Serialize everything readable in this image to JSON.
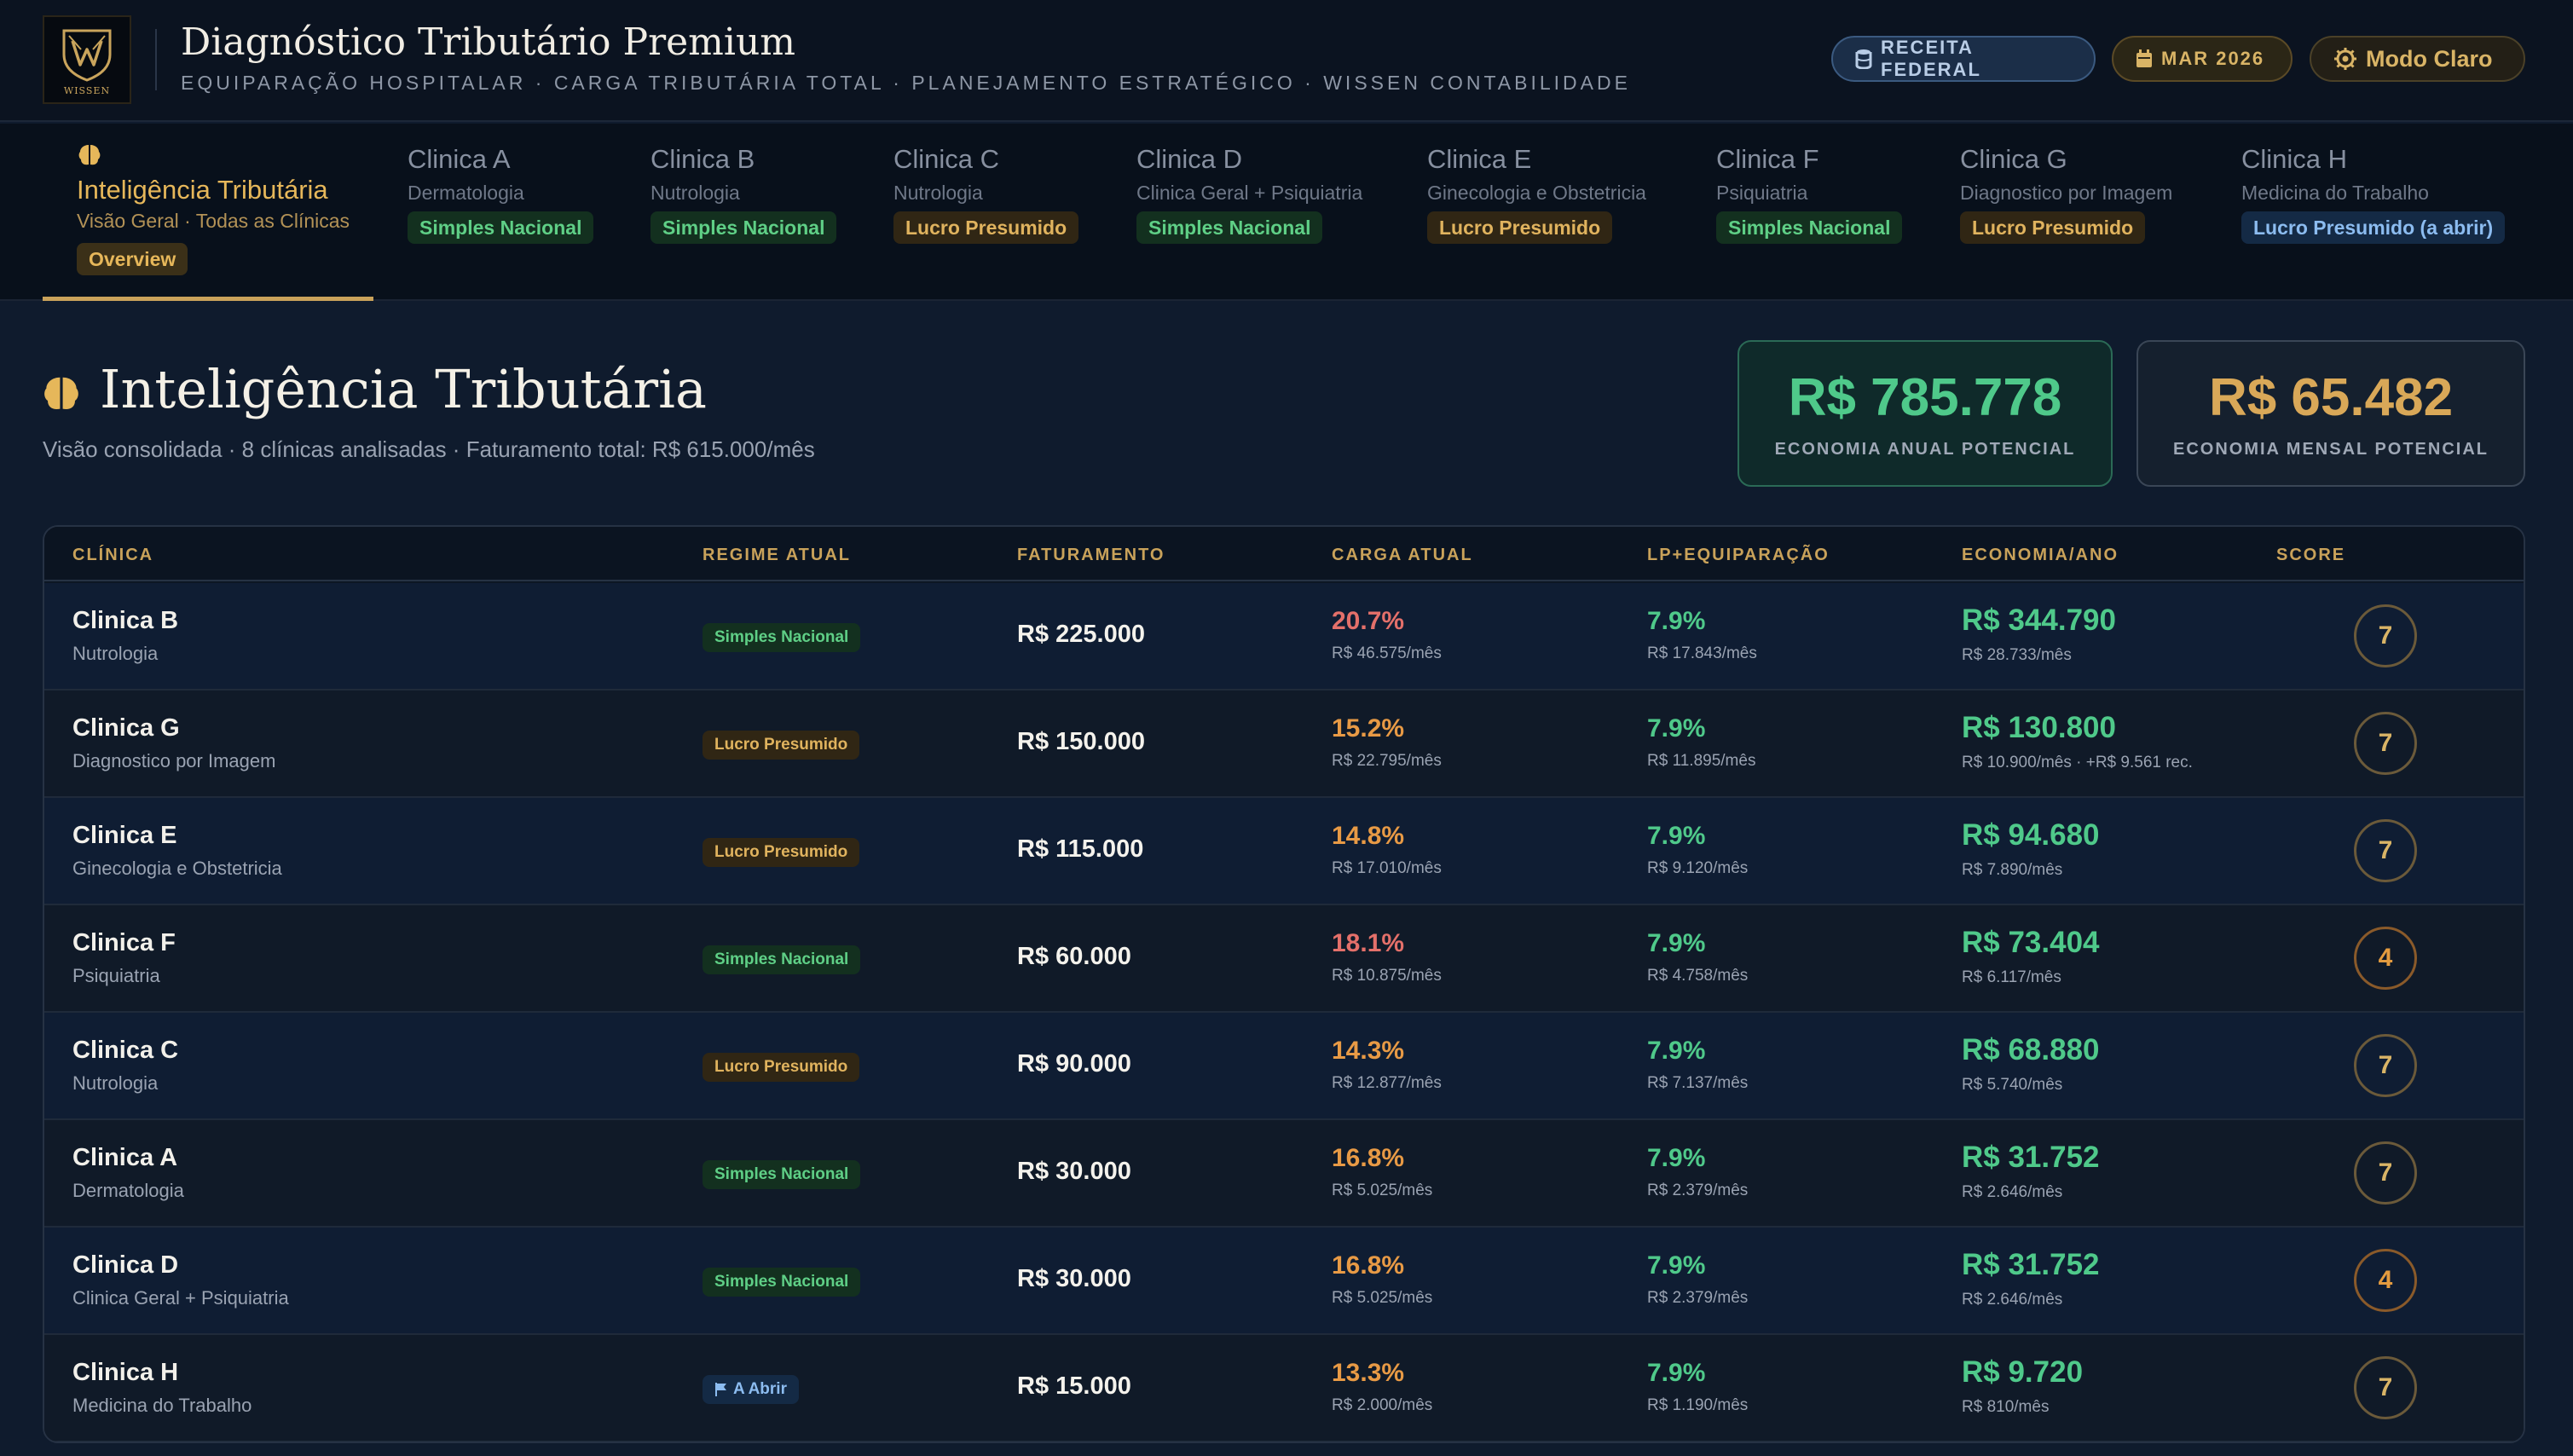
{
  "header": {
    "logo_text": "WISSEN",
    "title": "Diagnóstico Tributário Premium",
    "subtitle": "EQUIPARAÇÃO HOSPITALAR · CARGA TRIBUTÁRIA TOTAL · PLANEJAMENTO ESTRATÉGICO · WISSEN CONTABILIDADE",
    "receita_label": "RECEITA FEDERAL",
    "date_label": "MAR 2026",
    "theme_toggle_label": "Modo Claro"
  },
  "tabs": {
    "overview": {
      "name": "Inteligência Tributária",
      "sub": "Visão Geral · Todas as Clínicas",
      "badge": "Overview"
    },
    "clinics": [
      {
        "name": "Clinica A",
        "sub": "Dermatologia",
        "badge": "Simples Nacional",
        "badge_type": "sn"
      },
      {
        "name": "Clinica B",
        "sub": "Nutrologia",
        "badge": "Simples Nacional",
        "badge_type": "sn"
      },
      {
        "name": "Clinica C",
        "sub": "Nutrologia",
        "badge": "Lucro Presumido",
        "badge_type": "lp"
      },
      {
        "name": "Clinica D",
        "sub": "Clinica Geral + Psiquiatria",
        "badge": "Simples Nacional",
        "badge_type": "sn"
      },
      {
        "name": "Clinica E",
        "sub": "Ginecologia e Obstetricia",
        "badge": "Lucro Presumido",
        "badge_type": "lp"
      },
      {
        "name": "Clinica F",
        "sub": "Psiquiatria",
        "badge": "Simples Nacional",
        "badge_type": "sn"
      },
      {
        "name": "Clinica G",
        "sub": "Diagnostico por Imagem",
        "badge": "Lucro Presumido",
        "badge_type": "lp"
      },
      {
        "name": "Clinica H",
        "sub": "Medicina do Trabalho",
        "badge": "Lucro Presumido (a abrir)",
        "badge_type": "lpa"
      }
    ]
  },
  "main": {
    "title": "Inteligência Tributária",
    "subtitle": "Visão consolidada · 8 clínicas analisadas · Faturamento total: R$ 615.000/mês",
    "kpi_annual": {
      "value": "R$ 785.778",
      "label": "ECONOMIA ANUAL POTENCIAL"
    },
    "kpi_monthly": {
      "value": "R$ 65.482",
      "label": "ECONOMIA MENSAL POTENCIAL"
    }
  },
  "table": {
    "headers": [
      "CLÍNICA",
      "REGIME ATUAL",
      "FATURAMENTO",
      "CARGA ATUAL",
      "LP+EQUIPARAÇÃO",
      "ECONOMIA/ANO",
      "SCORE"
    ],
    "rows": [
      {
        "name": "Clinica B",
        "spec": "Nutrologia",
        "regime": "Simples Nacional",
        "regime_type": "sn",
        "faturamento": "R$ 225.000",
        "carga": "20.7%",
        "carga_color": "red",
        "carga_sub": "R$ 46.575/mês",
        "lp": "7.9%",
        "lp_sub": "R$ 17.843/mês",
        "eco": "R$ 344.790",
        "eco_sub": "R$ 28.733/mês",
        "score": "7"
      },
      {
        "name": "Clinica G",
        "spec": "Diagnostico por Imagem",
        "regime": "Lucro Presumido",
        "regime_type": "lp",
        "faturamento": "R$ 150.000",
        "carga": "15.2%",
        "carga_color": "orange",
        "carga_sub": "R$ 22.795/mês",
        "lp": "7.9%",
        "lp_sub": "R$ 11.895/mês",
        "eco": "R$ 130.800",
        "eco_sub": "R$ 10.900/mês · +R$ 9.561 rec.",
        "score": "7"
      },
      {
        "name": "Clinica E",
        "spec": "Ginecologia e Obstetricia",
        "regime": "Lucro Presumido",
        "regime_type": "lp",
        "faturamento": "R$ 115.000",
        "carga": "14.8%",
        "carga_color": "orange",
        "carga_sub": "R$ 17.010/mês",
        "lp": "7.9%",
        "lp_sub": "R$ 9.120/mês",
        "eco": "R$ 94.680",
        "eco_sub": "R$ 7.890/mês",
        "score": "7"
      },
      {
        "name": "Clinica F",
        "spec": "Psiquiatria",
        "regime": "Simples Nacional",
        "regime_type": "sn",
        "faturamento": "R$ 60.000",
        "carga": "18.1%",
        "carga_color": "red",
        "carga_sub": "R$ 10.875/mês",
        "lp": "7.9%",
        "lp_sub": "R$ 4.758/mês",
        "eco": "R$ 73.404",
        "eco_sub": "R$ 6.117/mês",
        "score": "4"
      },
      {
        "name": "Clinica C",
        "spec": "Nutrologia",
        "regime": "Lucro Presumido",
        "regime_type": "lp",
        "faturamento": "R$ 90.000",
        "carga": "14.3%",
        "carga_color": "orange",
        "carga_sub": "R$ 12.877/mês",
        "lp": "7.9%",
        "lp_sub": "R$ 7.137/mês",
        "eco": "R$ 68.880",
        "eco_sub": "R$ 5.740/mês",
        "score": "7"
      },
      {
        "name": "Clinica A",
        "spec": "Dermatologia",
        "regime": "Simples Nacional",
        "regime_type": "sn",
        "faturamento": "R$ 30.000",
        "carga": "16.8%",
        "carga_color": "orange",
        "carga_sub": "R$ 5.025/mês",
        "lp": "7.9%",
        "lp_sub": "R$ 2.379/mês",
        "eco": "R$ 31.752",
        "eco_sub": "R$ 2.646/mês",
        "score": "7"
      },
      {
        "name": "Clinica D",
        "spec": "Clinica Geral + Psiquiatria",
        "regime": "Simples Nacional",
        "regime_type": "sn",
        "faturamento": "R$ 30.000",
        "carga": "16.8%",
        "carga_color": "orange",
        "carga_sub": "R$ 5.025/mês",
        "lp": "7.9%",
        "lp_sub": "R$ 2.379/mês",
        "eco": "R$ 31.752",
        "eco_sub": "R$ 2.646/mês",
        "score": "4"
      },
      {
        "name": "Clinica H",
        "spec": "Medicina do Trabalho",
        "regime": "A Abrir",
        "regime_type": "lpa",
        "faturamento": "R$ 15.000",
        "carga": "13.3%",
        "carga_color": "orange",
        "carga_sub": "R$ 2.000/mês",
        "lp": "7.9%",
        "lp_sub": "R$ 1.190/mês",
        "eco": "R$ 9.720",
        "eco_sub": "R$ 810/mês",
        "score": "7"
      }
    ]
  }
}
